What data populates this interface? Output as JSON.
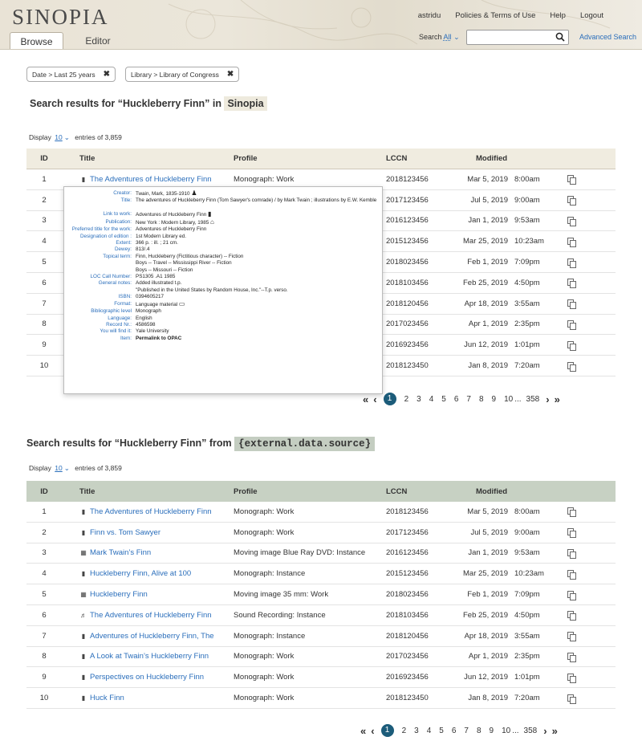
{
  "app": {
    "logo": "SINOPIA",
    "user": "astridu",
    "links": [
      "Policies & Terms of Use",
      "Help",
      "Logout"
    ],
    "tabs": [
      "Browse",
      "Editor"
    ],
    "search_label": "Search",
    "search_scope": "All",
    "advanced_search": "Advanced Search"
  },
  "filters": [
    "Date > Last 25 years",
    "Library > Library of Congress"
  ],
  "section1": {
    "title_prefix": "Search results for “Huckleberry Finn” in",
    "source": "Sinopia",
    "display": "Display",
    "entries_n": "10",
    "entries_total": "entries of 3,859"
  },
  "section2": {
    "title_prefix": "Search results for “Huckleberry Finn” from",
    "source": "{external.data.source}",
    "display": "Display",
    "entries_n": "10",
    "entries_total": "entries of 3,859"
  },
  "columns": [
    "ID",
    "Title",
    "Profile",
    "LCCN",
    "Modified"
  ],
  "rows1": [
    {
      "id": "1",
      "icon": "book-icon",
      "title": "The Adventures of Huckleberry Finn",
      "profile": "Monograph: Work",
      "lccn": "2018123456",
      "date": "Mar 5, 2019",
      "time": "8:00am"
    },
    {
      "id": "2",
      "icon": "",
      "title": "",
      "profile": "",
      "lccn": "2017123456",
      "date": "Jul 5, 2019",
      "time": "9:00am"
    },
    {
      "id": "3",
      "icon": "",
      "title": "",
      "profile": "",
      "lccn": "2016123456",
      "date": "Jan 1, 2019",
      "time": "9:53am"
    },
    {
      "id": "4",
      "icon": "",
      "title": "",
      "profile": "",
      "lccn": "2015123456",
      "date": "Mar 25, 2019",
      "time": "10:23am"
    },
    {
      "id": "5",
      "icon": "",
      "title": "",
      "profile": "",
      "lccn": "2018023456",
      "date": "Feb 1, 2019",
      "time": "7:09pm"
    },
    {
      "id": "6",
      "icon": "",
      "title": "",
      "profile": "",
      "lccn": "2018103456",
      "date": "Feb 25, 2019",
      "time": "4:50pm"
    },
    {
      "id": "7",
      "icon": "",
      "title": "",
      "profile": "",
      "lccn": "2018120456",
      "date": "Apr 18, 2019",
      "time": "3:55am"
    },
    {
      "id": "8",
      "icon": "",
      "title": "",
      "profile": "",
      "lccn": "2017023456",
      "date": "Apr 1, 2019",
      "time": "2:35pm"
    },
    {
      "id": "9",
      "icon": "",
      "title": "",
      "profile": "",
      "lccn": "2016923456",
      "date": "Jun 12, 2019",
      "time": "1:01pm"
    },
    {
      "id": "10",
      "icon": "",
      "title": "",
      "profile": "",
      "lccn": "2018123450",
      "date": "Jan 8, 2019",
      "time": "7:20am"
    }
  ],
  "rows2": [
    {
      "id": "1",
      "icon": "book-icon",
      "title": "The Adventures of Huckleberry Finn",
      "profile": "Monograph: Work",
      "lccn": "2018123456",
      "date": "Mar 5, 2019",
      "time": "8:00am"
    },
    {
      "id": "2",
      "icon": "book-icon",
      "title": "Finn vs. Tom Sawyer",
      "profile": "Monograph: Work",
      "lccn": "2017123456",
      "date": "Jul 5, 2019",
      "time": "9:00am"
    },
    {
      "id": "3",
      "icon": "film-icon",
      "title": "Mark Twain’s Finn",
      "profile": "Moving image Blue Ray DVD: Instance",
      "lccn": "2016123456",
      "date": "Jan 1, 2019",
      "time": "9:53am"
    },
    {
      "id": "4",
      "icon": "book-icon",
      "title": "Huckleberry Finn, Alive at 100",
      "profile": "Monograph: Instance",
      "lccn": "2015123456",
      "date": "Mar 25, 2019",
      "time": "10:23am"
    },
    {
      "id": "5",
      "icon": "film-icon",
      "title": "Huckleberry Finn",
      "profile": "Moving image 35 mm: Work",
      "lccn": "2018023456",
      "date": "Feb 1, 2019",
      "time": "7:09pm"
    },
    {
      "id": "6",
      "icon": "music-icon",
      "title": "The Adventures of Huckleberry Finn",
      "profile": "Sound Recording: Instance",
      "lccn": "2018103456",
      "date": "Feb 25, 2019",
      "time": "4:50pm"
    },
    {
      "id": "7",
      "icon": "book-icon",
      "title": "Adventures of Huckleberry Finn, The",
      "profile": "Monograph: Instance",
      "lccn": "2018120456",
      "date": "Apr 18, 2019",
      "time": "3:55am"
    },
    {
      "id": "8",
      "icon": "book-icon",
      "title": "A Look at Twain’s Huckleberry Finn",
      "profile": "Monograph: Work",
      "lccn": "2017023456",
      "date": "Apr 1, 2019",
      "time": "2:35pm"
    },
    {
      "id": "9",
      "icon": "book-icon",
      "title": "Perspectives on Huckleberry Finn",
      "profile": "Monograph: Work",
      "lccn": "2016923456",
      "date": "Jun 12, 2019",
      "time": "1:01pm"
    },
    {
      "id": "10",
      "icon": "book-icon",
      "title": "Huck Finn",
      "profile": "Monograph: Work",
      "lccn": "2018123450",
      "date": "Jan 8, 2019",
      "time": "7:20am"
    }
  ],
  "pagination": {
    "current": "1",
    "pages": [
      "2",
      "3",
      "4",
      "5",
      "6",
      "7",
      "8",
      "9",
      "10"
    ],
    "ellipsis": "...",
    "last": "358"
  },
  "popover": [
    {
      "k": "Creator:",
      "v": "Twain, Mark, 1835-1910",
      "icon": "person-icon"
    },
    {
      "k": "Title:",
      "v": "The adventures of Huckleberry Finn (Tom Sawyer's comrade) / by Mark Twain ; illustrations by E.W. Kemble"
    },
    {
      "k": "",
      "v": ""
    },
    {
      "k": "Link to work:",
      "v": "Adventures of Huckleberry Finn",
      "icon": "book-icon"
    },
    {
      "k": "Publication:",
      "v": "New York : Modern Library, 1985",
      "icon": "building-icon"
    },
    {
      "k": "Preferred title for the work:",
      "v": "Adventures of Huckleberry Finn"
    },
    {
      "k": "Designation of edition :",
      "v": "1st Modern Library ed."
    },
    {
      "k": "Extent:",
      "v": "366 p. : ill. ; 21 cm."
    },
    {
      "k": "Dewey:",
      "v": "813/.4"
    },
    {
      "k": "Topical term:",
      "v": "Finn, Huckleberry (Fictitious character) -- Fiction"
    },
    {
      "k": "",
      "v": "Boys -- Travel -- Mississippi River -- Fiction"
    },
    {
      "k": "",
      "v": "Boys -- Missouri -- Fiction"
    },
    {
      "k": "LOC Call Number:",
      "v": "PS1305 .A1 1985"
    },
    {
      "k": "General notes:",
      "v": "Added illustrated t.p."
    },
    {
      "k": "",
      "v": "\"Published in the United States by Random House, Inc.\"--T.p. verso."
    },
    {
      "k": "ISBN:",
      "v": "0394605217"
    },
    {
      "k": "Format:",
      "v": "Language material",
      "icon": "text-icon"
    },
    {
      "k": "Bibliographic level",
      "v": "Monograph"
    },
    {
      "k": "Language:",
      "v": "English"
    },
    {
      "k": "Record Nr.:",
      "v": "4586598"
    },
    {
      "k": "You will find it:",
      "v": "Yale University"
    },
    {
      "k": "Item:",
      "v": "Permalink to OPAC",
      "bold": true
    }
  ],
  "colors": {
    "accent": "#2a6ebb",
    "header_bg": "#eae5d9",
    "table1_head": "#f0ece0",
    "table2_head": "#c7d1c3",
    "page_current": "#1c5c7a"
  }
}
